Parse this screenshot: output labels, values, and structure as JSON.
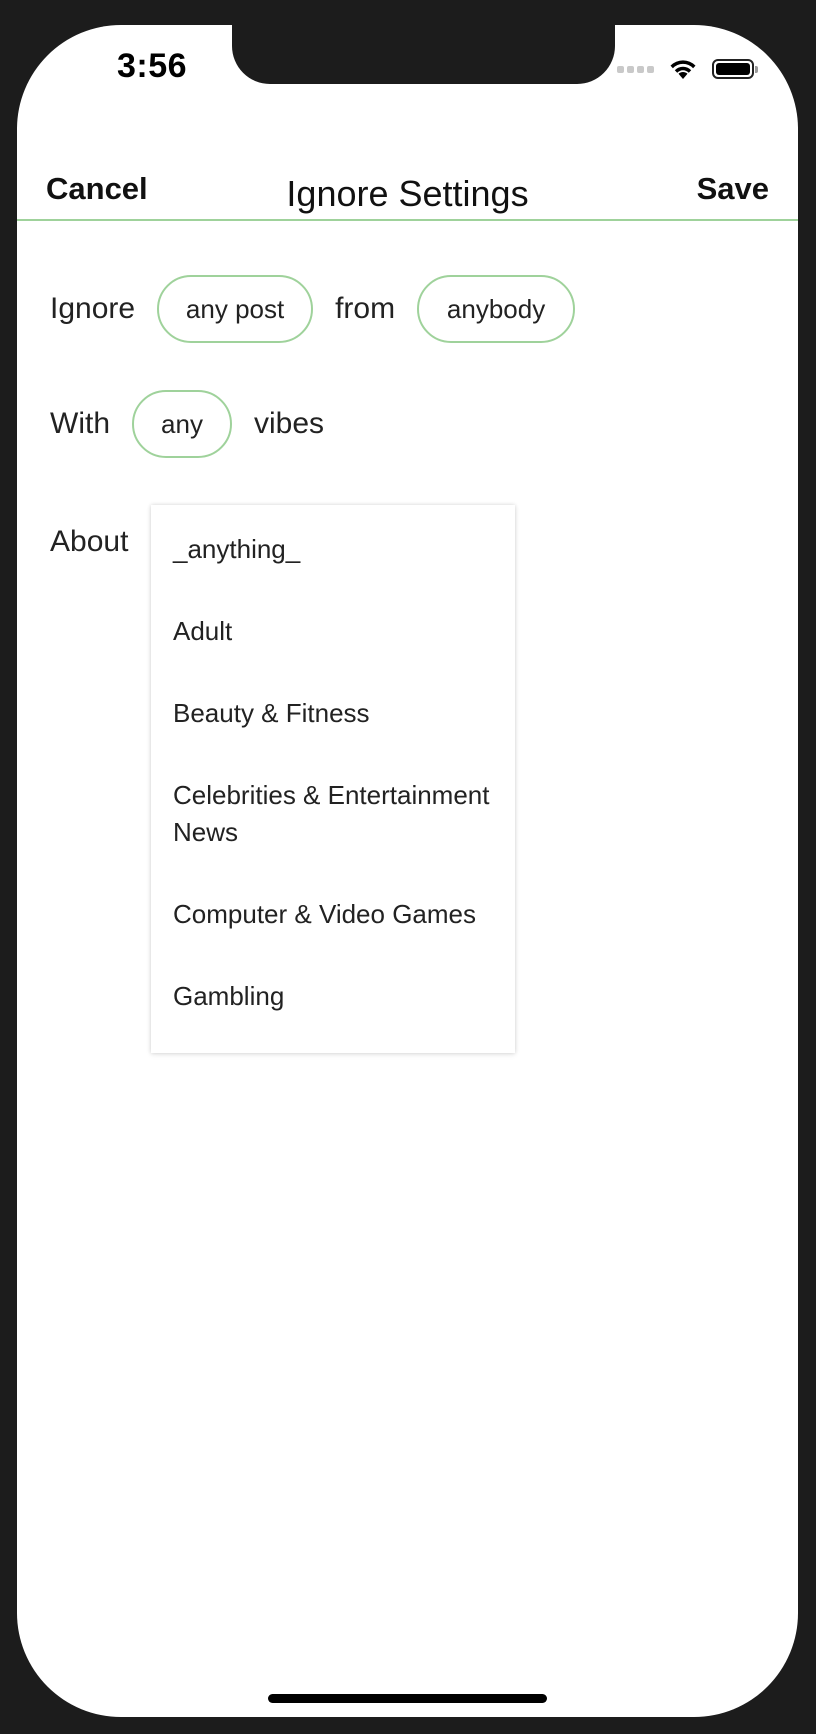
{
  "status_bar": {
    "time": "3:56",
    "icons": [
      "cellular-signal-icon",
      "wifi-icon",
      "battery-icon"
    ]
  },
  "header": {
    "cancel_label": "Cancel",
    "title": "Ignore Settings",
    "save_label": "Save"
  },
  "filter": {
    "ignore_label": "Ignore",
    "post_value": "any post",
    "from_label": "from",
    "author_value": "anybody",
    "with_label": "With",
    "vibes_value": "any",
    "vibes_label": "vibes",
    "about_label": "About"
  },
  "topics_dropdown": {
    "options": [
      "_anything_",
      "Adult",
      "Beauty & Fitness",
      "Celebrities & Entertainment News",
      "Computer & Video Games",
      "Gambling"
    ]
  },
  "colors": {
    "accent": "#9fd29b",
    "device_frame": "#1c1c1c",
    "text": "#222222"
  }
}
